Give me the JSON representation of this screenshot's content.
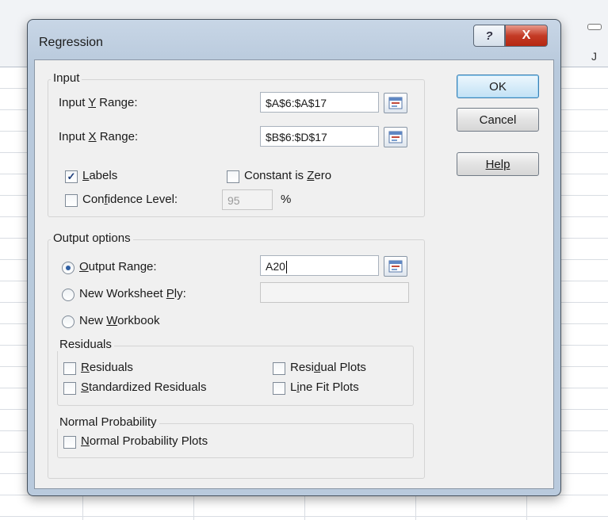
{
  "sheet": {
    "column_label": "J"
  },
  "dialog": {
    "title": "Regression",
    "help_glyph": "?",
    "close_glyph": "X",
    "buttons": {
      "ok": "OK",
      "cancel": "Cancel",
      "help": "Help"
    },
    "input": {
      "group_label": "Input",
      "y_range_label": "Input Y Range:",
      "y_range_value": "$A$6:$A$17",
      "x_range_label": "Input X Range:",
      "x_range_value": "$B$6:$D$17",
      "labels": {
        "label": "Labels",
        "checked": true
      },
      "constant_zero": {
        "label": "Constant is Zero",
        "checked": false
      },
      "confidence": {
        "label": "Confidence Level:",
        "checked": false,
        "value": "95",
        "unit": "%"
      }
    },
    "output": {
      "group_label": "Output options",
      "output_range": {
        "label": "Output Range:",
        "selected": true,
        "value": "A20"
      },
      "new_ply": {
        "label": "New Worksheet Ply:",
        "selected": false,
        "value": ""
      },
      "new_workbook": {
        "label": "New Workbook",
        "selected": false
      }
    },
    "residuals": {
      "group_label": "Residuals",
      "residuals": {
        "label": "Residuals",
        "checked": false
      },
      "standardized": {
        "label": "Standardized Residuals",
        "checked": false
      },
      "residual_plots": {
        "label": "Residual Plots",
        "checked": false
      },
      "line_fit": {
        "label": "Line Fit Plots",
        "checked": false
      }
    },
    "normal_probability": {
      "group_label": "Normal Probability",
      "plots": {
        "label": "Normal Probability Plots",
        "checked": false
      }
    }
  }
}
